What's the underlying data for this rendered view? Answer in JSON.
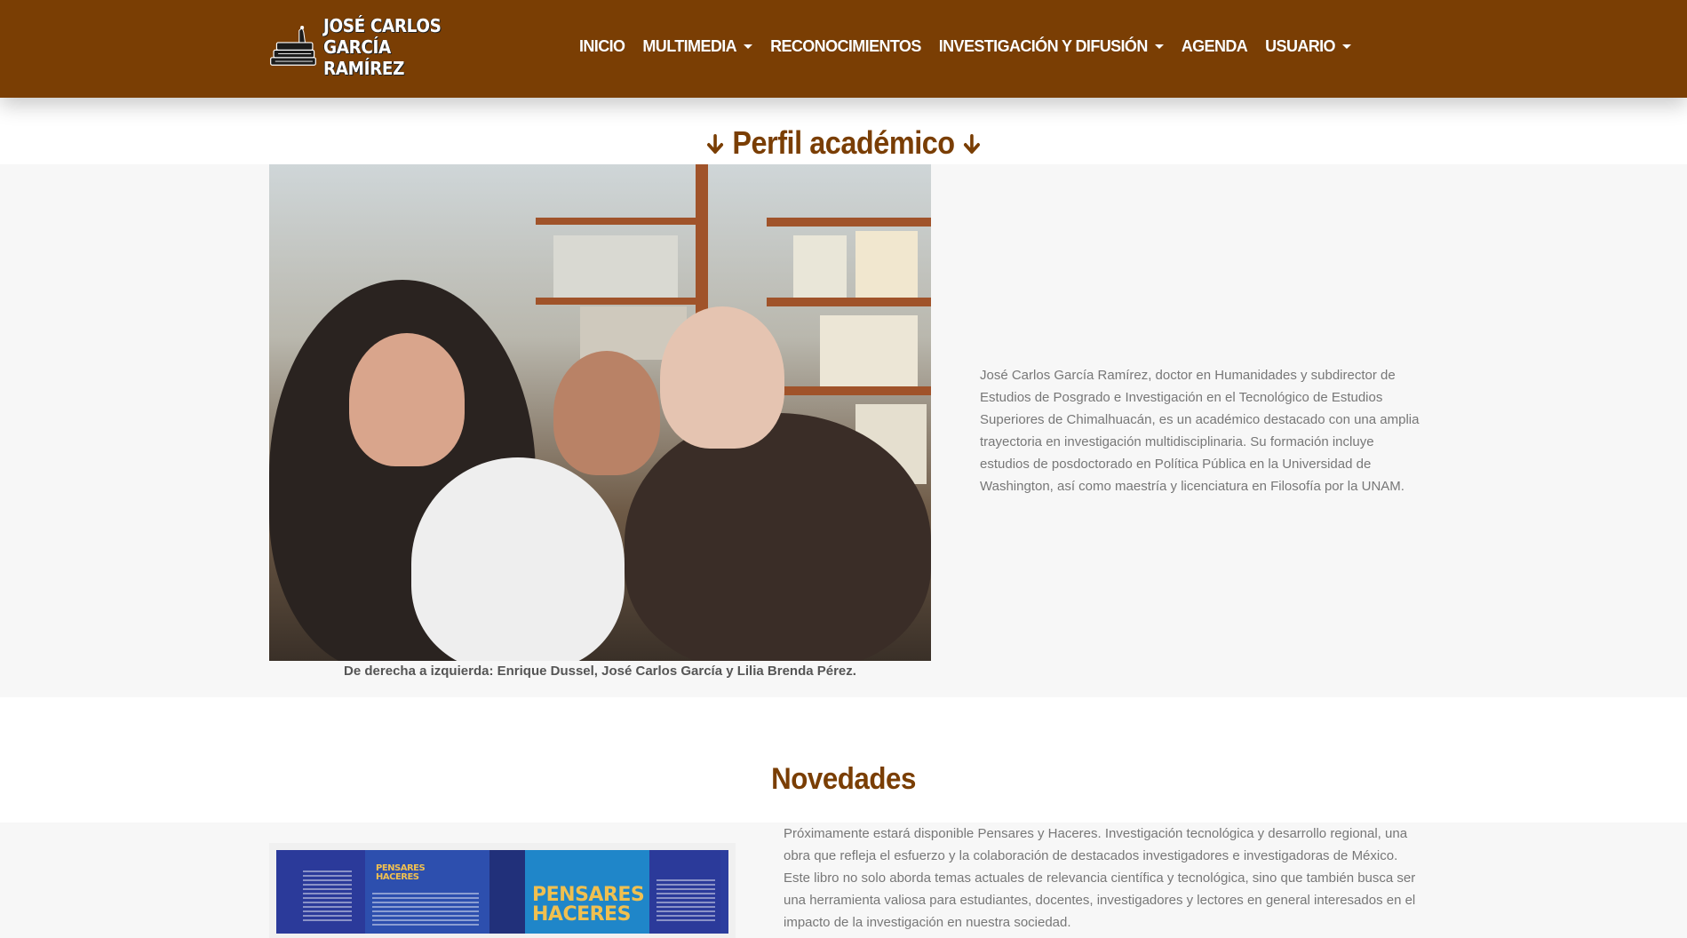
{
  "brand": {
    "line1": "JOSÉ CARLOS",
    "line2": "GARCÍA RAMÍREZ"
  },
  "nav": {
    "items": [
      {
        "label": "INICIO",
        "dropdown": false
      },
      {
        "label": "MULTIMEDIA",
        "dropdown": true
      },
      {
        "label": "RECONOCIMIENTOS",
        "dropdown": false
      },
      {
        "label": "INVESTIGACIÓN Y DIFUSIÓN",
        "dropdown": true
      },
      {
        "label": "AGENDA",
        "dropdown": false
      },
      {
        "label": "USUARIO",
        "dropdown": true
      }
    ]
  },
  "perfil": {
    "title": "Perfil académico",
    "arrow": "➜",
    "caption": "De derecha a izquierda: Enrique Dussel, José Carlos García y Lilia Brenda Pérez.",
    "text": "José Carlos García Ramírez, doctor en Humanidades y subdirector de Estudios de Posgrado e Investigación en el Tecnológico de Estudios Superiores de Chimalhuacán, es un académico destacado con una amplia trayectoria en investigación multidisciplinaria. Su formación incluye estudios de posdoctorado en Política Pública en la Universidad de Washington, así como maestría y licenciatura en Filosofía por la UNAM."
  },
  "novedades": {
    "title": "Novedades",
    "text": "Próximamente estará disponible Pensares y Haceres. Investigación tecnológica y desarrollo regional, una obra que refleja el esfuerzo y la colaboración de destacados investigadores e investigadoras de México. Este libro no solo aborda temas actuales de relevancia científica y tecnológica, sino que también busca ser una herramienta valiosa para estudiantes, docentes, investigadores y lectores en general interesados en el impacto de la investigación en nuestra sociedad.",
    "cover_title_small_1": "PENSARES",
    "cover_title_small_2": "HACERES",
    "cover_title_big_1": "PENSARES",
    "cover_title_big_2": "HACERES"
  },
  "colors": {
    "brand": "#7a3e04",
    "nav_text": "#ffffff",
    "body_text": "#777777",
    "section_bg": "#f7f7f7"
  },
  "icons": {
    "logo": "books-stack-icon",
    "title_arrow": "arrow-down-icon",
    "dropdown": "caret-down-icon"
  }
}
